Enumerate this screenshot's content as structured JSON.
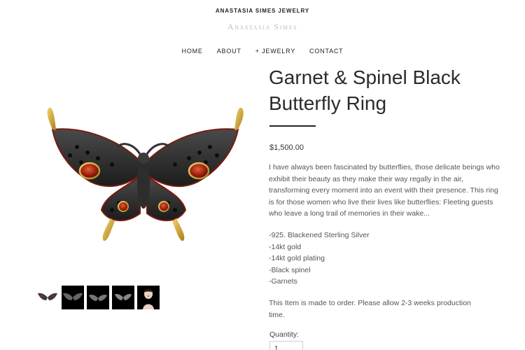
{
  "site": {
    "brand_small": "ANASTASIA SIMES JEWELRY",
    "logo_text": "Anastasia Simes"
  },
  "nav": {
    "items": [
      {
        "label": "HOME"
      },
      {
        "label": "ABOUT"
      },
      {
        "label": "+ JEWELRY"
      },
      {
        "label": "CONTACT"
      }
    ]
  },
  "product": {
    "title": "Garnet & Spinel Black Butterfly Ring",
    "price": "$1,500.00",
    "description": "I have always been fascinated by butterflies, those delicate beings who exhibit their beauty as they make their way regally in the air, transforming every moment into an event with their presence. This ring is for those women who live their lives like butterflies: Fleeting guests who leave a long trail of memories in their wake...",
    "specs": [
      "-925. Blackened Sterling Silver",
      "-14kt gold",
      "-14kt gold plating",
      "-Black spinel",
      "-Garnets"
    ],
    "made_to_order": "This Item is made to order. Please allow 2-3 weeks production time.",
    "quantity_label": "Quantity:",
    "quantity_value": "1"
  },
  "thumbnails": {
    "count_visible": 5,
    "icons": [
      "butterfly-ring-front",
      "butterfly-ring-dark",
      "butterfly-ring-angle",
      "butterfly-ring-top",
      "model-wearing-ring"
    ]
  },
  "colors": {
    "brand_gray": "#bdbdbd",
    "text_dark": "#2b2b2b",
    "gold": "#c9a43a",
    "garnet": "#9b1f12"
  }
}
